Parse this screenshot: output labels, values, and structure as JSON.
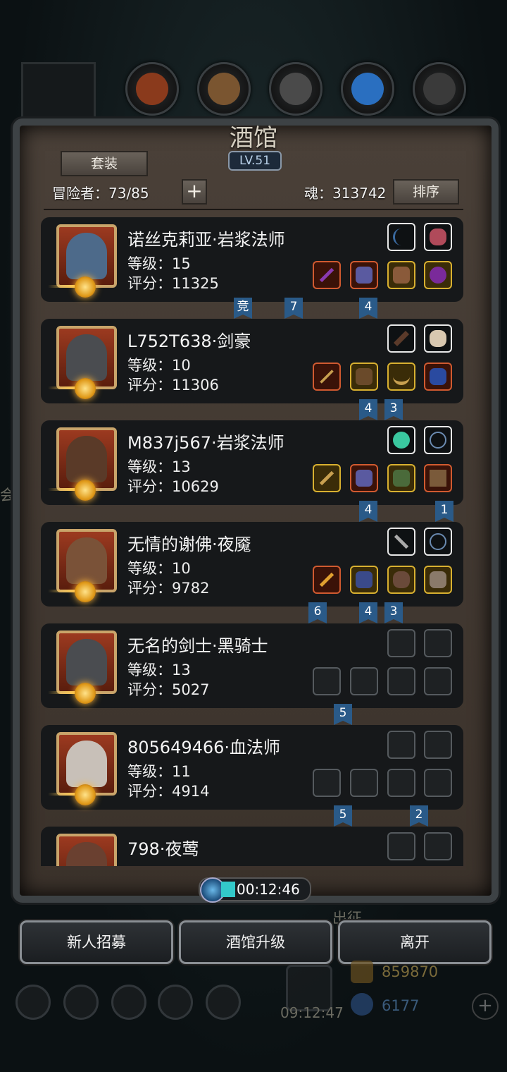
{
  "tavern": {
    "title": "酒馆",
    "level": "LV.51",
    "suit_button": "套装",
    "adventurers_label": "冒险者：73/85",
    "add_symbol": "+",
    "souls_label": "魂：313742",
    "sort_button": "排序"
  },
  "heroes": [
    {
      "name": "诺丝克莉亚·岩浆法师",
      "level": "等级：15",
      "score": "评分：11325",
      "ribbons": [
        "竞",
        "7",
        "4"
      ]
    },
    {
      "name": "L752T638·剑豪",
      "level": "等级：10",
      "score": "评分：11306",
      "ribbons": [
        "4",
        "3"
      ]
    },
    {
      "name": "M837j567·岩浆法师",
      "level": "等级：13",
      "score": "评分：10629",
      "ribbons": [
        "4",
        "1"
      ]
    },
    {
      "name": "无情的谢佛·夜魇",
      "level": "等级：10",
      "score": "评分：9782",
      "ribbons": [
        "6",
        "4",
        "3"
      ]
    },
    {
      "name": "无名的剑士·黑骑士",
      "level": "等级：13",
      "score": "评分：5027",
      "ribbons": [
        "5"
      ]
    },
    {
      "name": "805649466·血法师",
      "level": "等级：11",
      "score": "评分：4914",
      "ribbons": [
        "5",
        "2"
      ]
    },
    {
      "name": "798·夜莺",
      "level": "",
      "score": "",
      "ribbons": []
    }
  ],
  "timer": "00:12:46",
  "buttons": {
    "recruit": "新人招募",
    "upgrade": "酒馆升级",
    "leave": "离开"
  },
  "background": {
    "gift_timer": "09:12:47",
    "gold": "859870",
    "gems": "6177",
    "behind_text_1": "出征",
    "behind_text_2": "会"
  },
  "colors": {
    "frame": "#3d4245",
    "ribbon": "#2a5a88",
    "accent_cyan": "#33c9c9"
  }
}
